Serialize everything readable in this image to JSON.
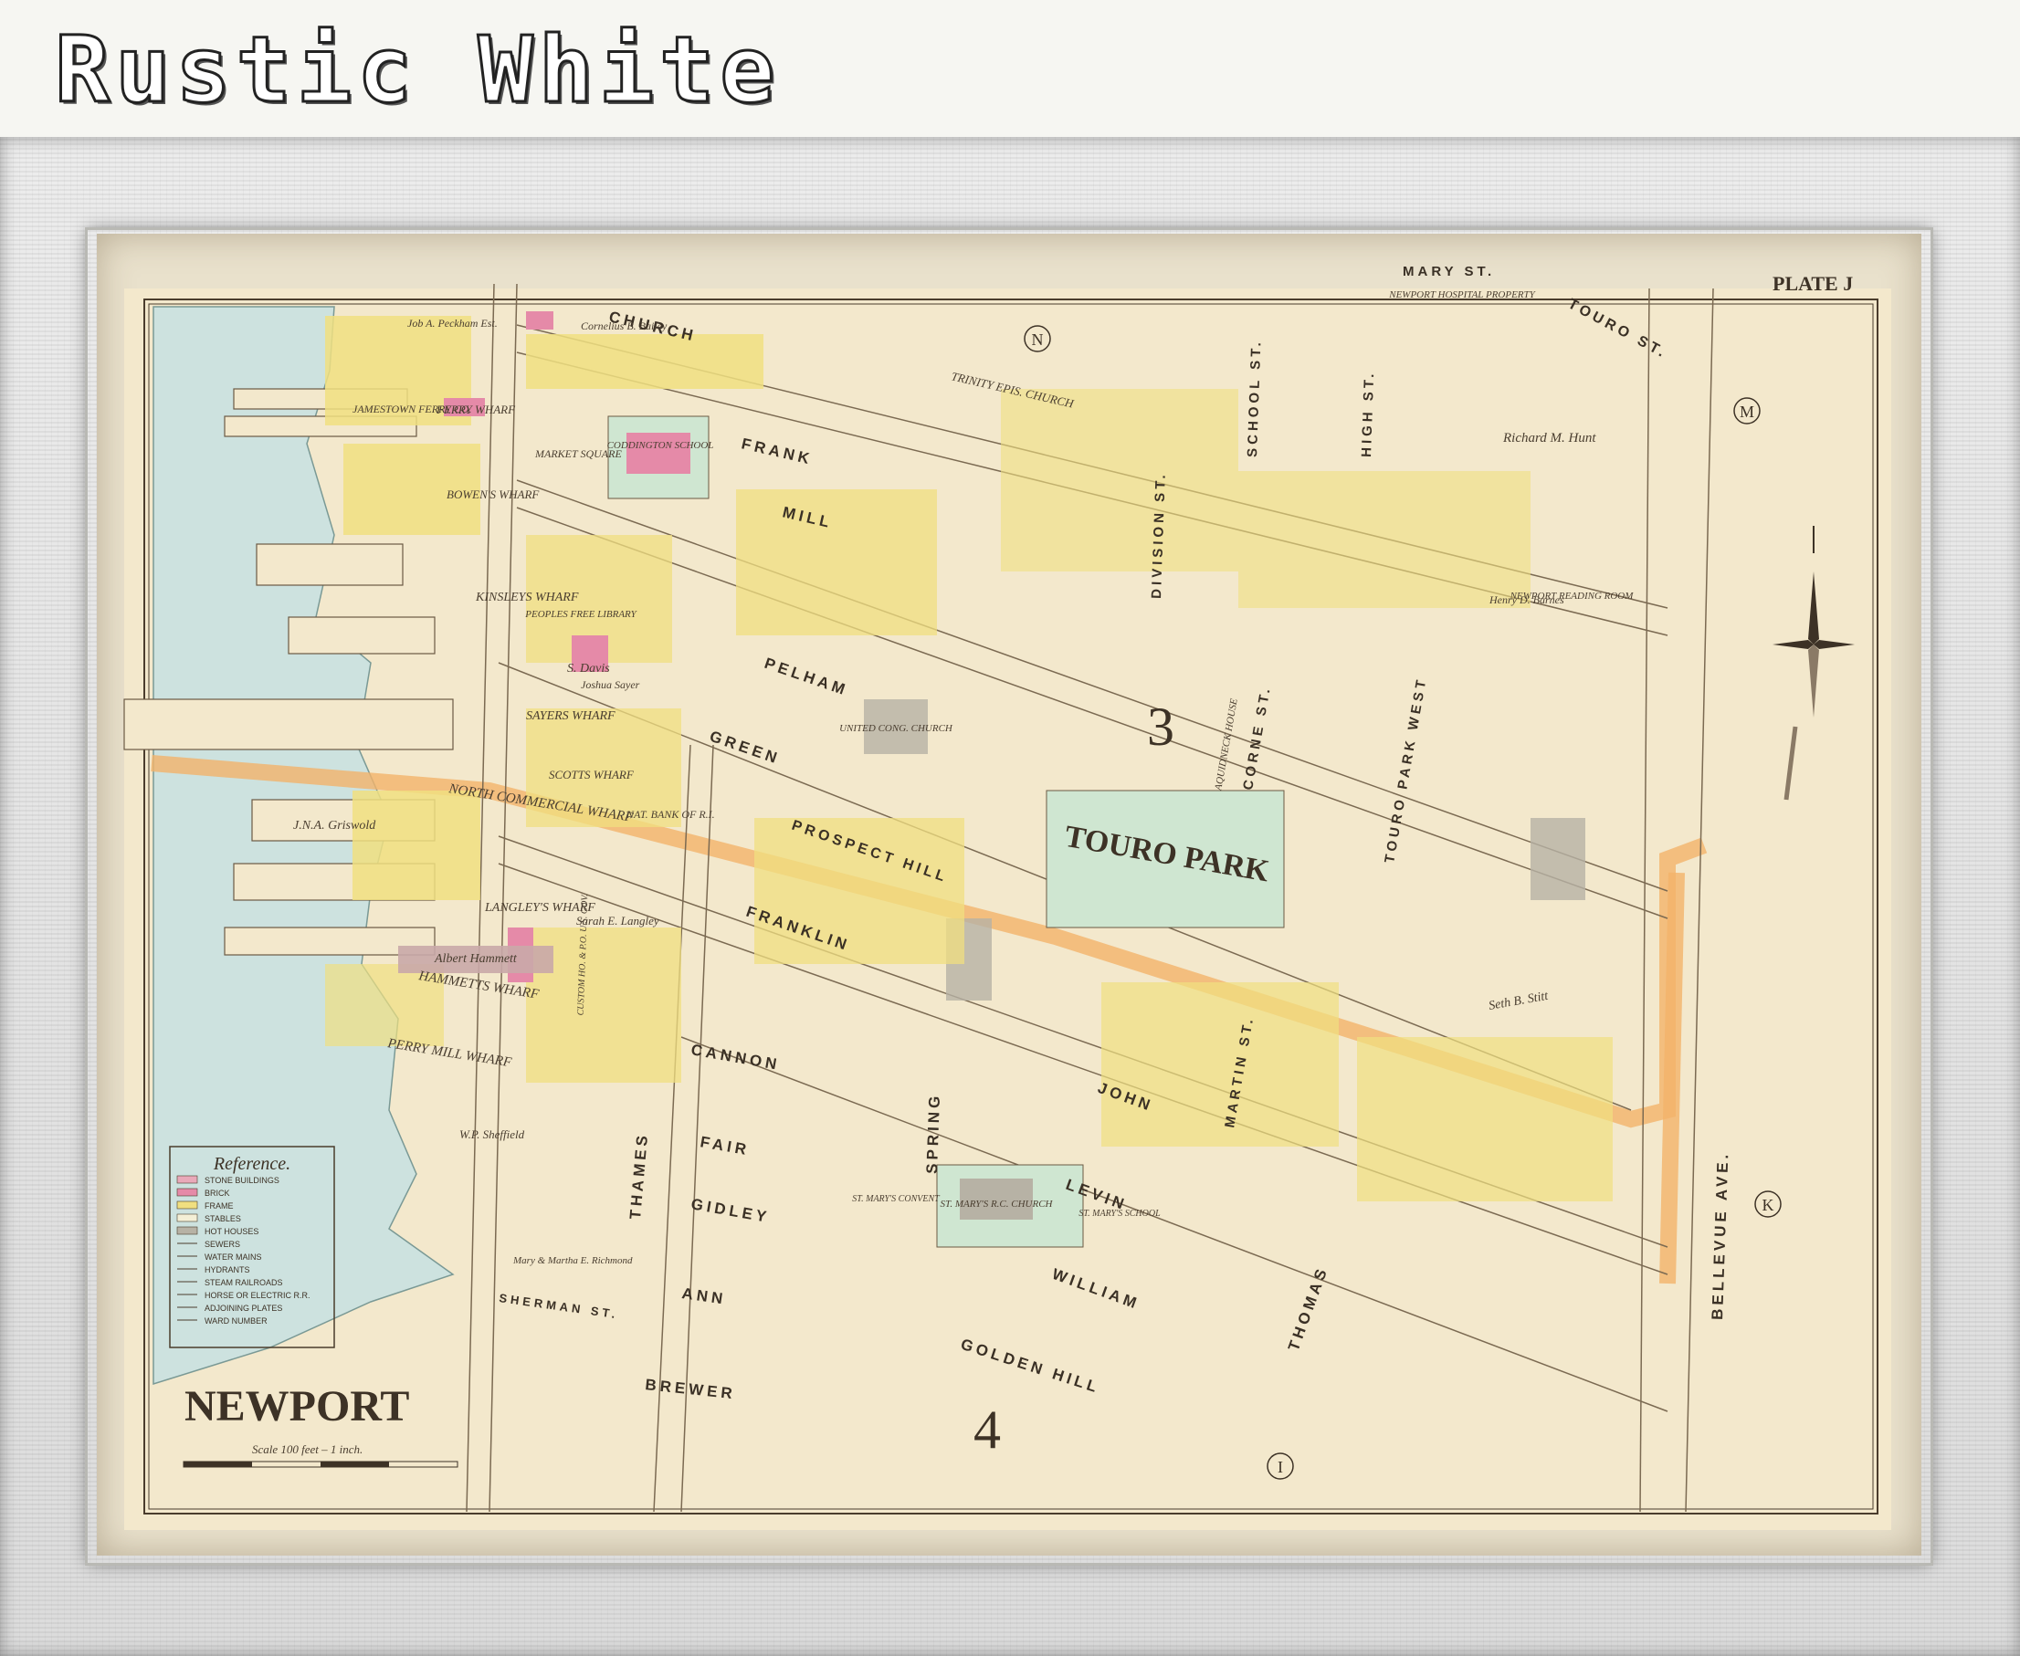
{
  "frame": {
    "title": "Rustic White"
  },
  "map": {
    "name": "NEWPORT",
    "plate": "PLATE J",
    "scale": "Scale 100 feet – 1 inch.",
    "ward_numbers": [
      "3",
      "4"
    ],
    "adjoining_plates": [
      "N",
      "M",
      "K",
      "I"
    ],
    "legend": {
      "title": "Reference.",
      "items": [
        {
          "label": "STONE BUILDINGS",
          "color": "#e9a9b9"
        },
        {
          "label": "BRICK",
          "color": "#e58aa8"
        },
        {
          "label": "FRAME",
          "color": "#f0df80"
        },
        {
          "label": "STABLES",
          "color": "#f4efd6"
        },
        {
          "label": "HOT HOUSES",
          "color": "#b7b2a5"
        },
        {
          "label": "SEWERS",
          "color": ""
        },
        {
          "label": "WATER MAINS",
          "color": ""
        },
        {
          "label": "HYDRANTS",
          "color": ""
        },
        {
          "label": "STEAM RAILROADS",
          "color": ""
        },
        {
          "label": "HORSE OR ELECTRIC R.R.",
          "color": ""
        },
        {
          "label": "ADJOINING PLATES",
          "color": ""
        },
        {
          "label": "WARD NUMBER",
          "color": ""
        }
      ]
    },
    "streets": {
      "church": "CHURCH",
      "frank": "FRANK",
      "mill": "MILL",
      "pelham": "PELHAM",
      "green": "GREEN",
      "prospect_hill": "PROSPECT HILL",
      "franklin": "FRANKLIN",
      "cannon": "CANNON",
      "fair": "FAIR",
      "gidley": "GIDLEY",
      "ann": "ANN",
      "brewer": "BREWER",
      "thames": "THAMES",
      "spring": "SPRING",
      "john": "JOHN",
      "levin": "LEVIN",
      "william": "WILLIAM",
      "golden_hill": "GOLDEN HILL",
      "thomas": "THOMAS",
      "bellevue_ave": "BELLEVUE AVE.",
      "touro_st": "TOURO ST.",
      "mary_st": "MARY ST.",
      "school_st": "SCHOOL ST.",
      "high_st": "HIGH ST.",
      "division_st": "DIVISION ST.",
      "corne_st": "CORNE ST.",
      "touro_park_west": "TOURO PARK WEST",
      "martin_st": "MARTIN ST.",
      "sherman_st": "SHERMAN ST.",
      "st_abbrev": "ST."
    },
    "wharves": [
      "FERRY WHARF",
      "BOWEN'S WHARF",
      "KINSLEYS WHARF",
      "SAYERS WHARF",
      "SCOTTS WHARF",
      "NORTH COMMERCIAL WHARF",
      "LANGLEY'S WHARF",
      "HAMMETTS WHARF",
      "PERRY MILL WHARF",
      "JAMESTOWN FERRY CO."
    ],
    "landmarks": [
      "TRINITY EPIS. CHURCH",
      "CODDINGTON SCHOOL",
      "PEOPLES FREE LIBRARY",
      "UNITED CONG. CHURCH",
      "TOURO PARK",
      "NEWPORT READING ROOM",
      "ST. MARY'S R.C. CHURCH",
      "ST. MARY'S SCHOOL",
      "ST. MARY'S CONVENT",
      "NEWPORT HOSPITAL PROPERTY",
      "AQUIDNECK HOUSE",
      "CUSTOM HO. & P.O. U.S. GOV.",
      "MARKET SQUARE",
      "NAT. BANK OF R.I."
    ],
    "owners": [
      "Richard M. Hunt",
      "Seth B. Stitt",
      "J.N.A. Griswold",
      "Albert Hammett",
      "Sarah E. Langley",
      "S. Davis",
      "W.P. Sheffield",
      "Mary & Martha E. Richmond",
      "Henry D. Barnes",
      "Joshua Sayer",
      "Job A. Peckham Est.",
      "Cornelius B. Bailey"
    ]
  }
}
